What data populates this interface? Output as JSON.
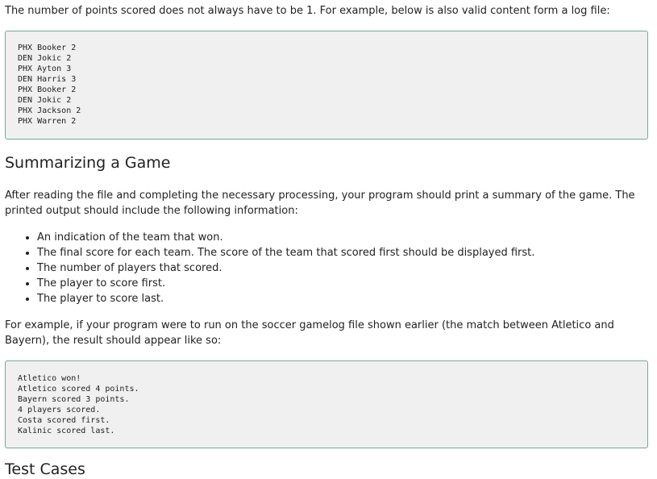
{
  "intro_text": "The number of points scored does not always have to be 1. For example, below is also valid content form a log file:",
  "log_example": "PHX Booker 2\nDEN Jokic 2\nPHX Ayton 3\nDEN Harris 3\nPHX Booker 2\nDEN Jokic 2\nPHX Jackson 2\nPHX Warren 2",
  "summarizing_heading": "Summarizing a Game",
  "summary_intro": "After reading the file and completing the necessary processing, your program should print a summary of the game. The printed output should include the following information:",
  "summary_items": [
    "An indication of the team that won.",
    "The final score for each team. The score of the team that scored first should be displayed first.",
    "The number of players that scored.",
    "The player to score first.",
    "The player to score last."
  ],
  "example_text": "For example, if your program were to run on the soccer gamelog file shown earlier (the match between Atletico and Bayern), the result should appear like so:",
  "output_example": "Atletico won!\nAtletico scored 4 points.\nBayern scored 3 points.\n4 players scored.\nCosta scored first.\nKalinic scored last.",
  "test_cases_heading": "Test Cases"
}
